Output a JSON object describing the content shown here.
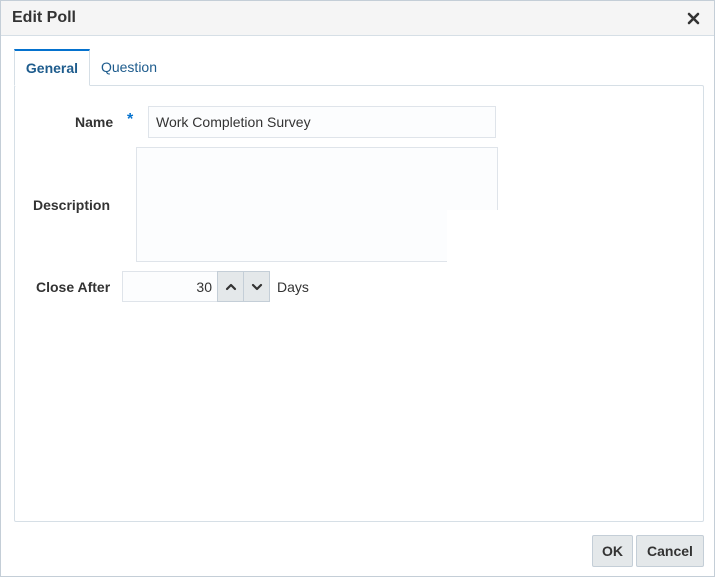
{
  "dialog": {
    "title": "Edit Poll",
    "close_icon": "close-icon"
  },
  "tabs": [
    {
      "label": "General",
      "selected": true
    },
    {
      "label": "Question",
      "selected": false
    }
  ],
  "form": {
    "name_label": "Name",
    "required_marker": "*",
    "name_value": "Work Completion Survey",
    "description_label": "Description",
    "description_value": "",
    "close_after_label": "Close After",
    "close_after_value": "30",
    "close_after_unit": "Days",
    "increment_icon": "chevron-up-icon",
    "decrement_icon": "chevron-down-icon"
  },
  "footer": {
    "ok_label": "OK",
    "cancel_label": "Cancel"
  },
  "colors": {
    "accent": "#0572ce",
    "tab_text": "#1e5c8d",
    "text": "#333333"
  }
}
